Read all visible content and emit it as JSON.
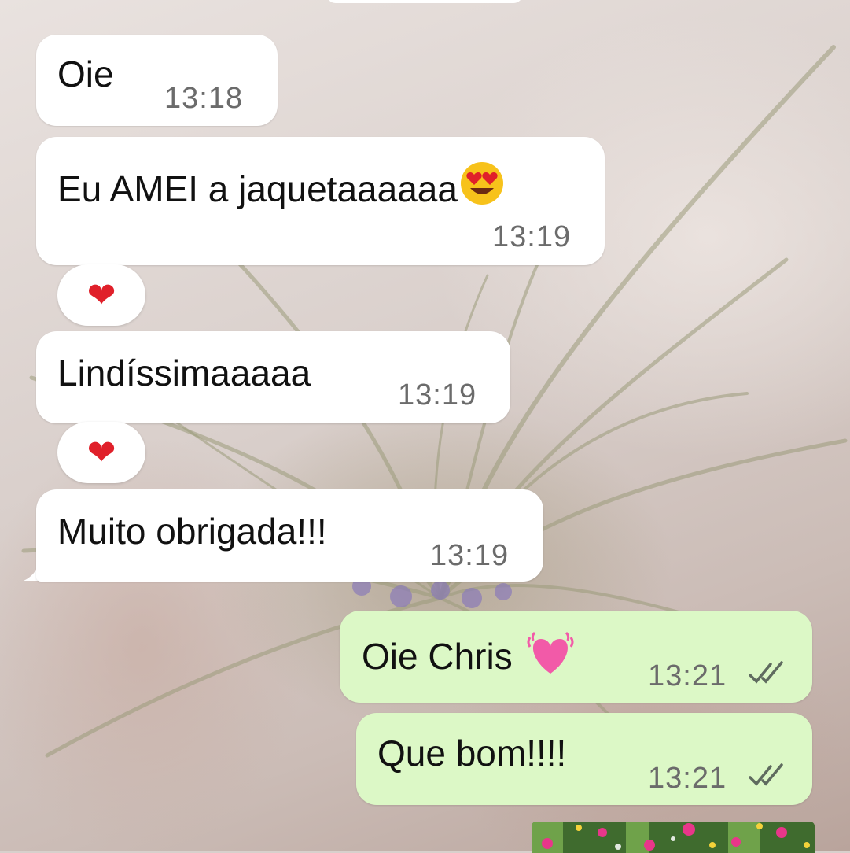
{
  "chat": {
    "messages": [
      {
        "direction": "in",
        "text": "Oie",
        "time": "13:18"
      },
      {
        "direction": "in",
        "text": "Eu AMEI a jaquetaaaaaa",
        "emoji": "heart-eyes-emoji",
        "time": "13:19",
        "reaction": "❤"
      },
      {
        "direction": "in",
        "text": "Lindíssimaaaaa",
        "time": "13:19",
        "reaction": "❤"
      },
      {
        "direction": "in",
        "text": "Muito obrigada!!!",
        "time": "13:19"
      },
      {
        "direction": "out",
        "text": "Oie Chris",
        "emoji": "growing-heart-emoji",
        "time": "13:21",
        "status": "read-double-check"
      },
      {
        "direction": "out",
        "text": "Que bom!!!!",
        "time": "13:21",
        "status": "read-double-check"
      }
    ],
    "attachment": {
      "type": "image",
      "icon": "flowers-photo"
    }
  },
  "colors": {
    "incoming_bubble": "#ffffff",
    "outgoing_bubble": "#dcf8c6",
    "timestamp": "#6b6b6b",
    "heart": "#e0202a"
  }
}
